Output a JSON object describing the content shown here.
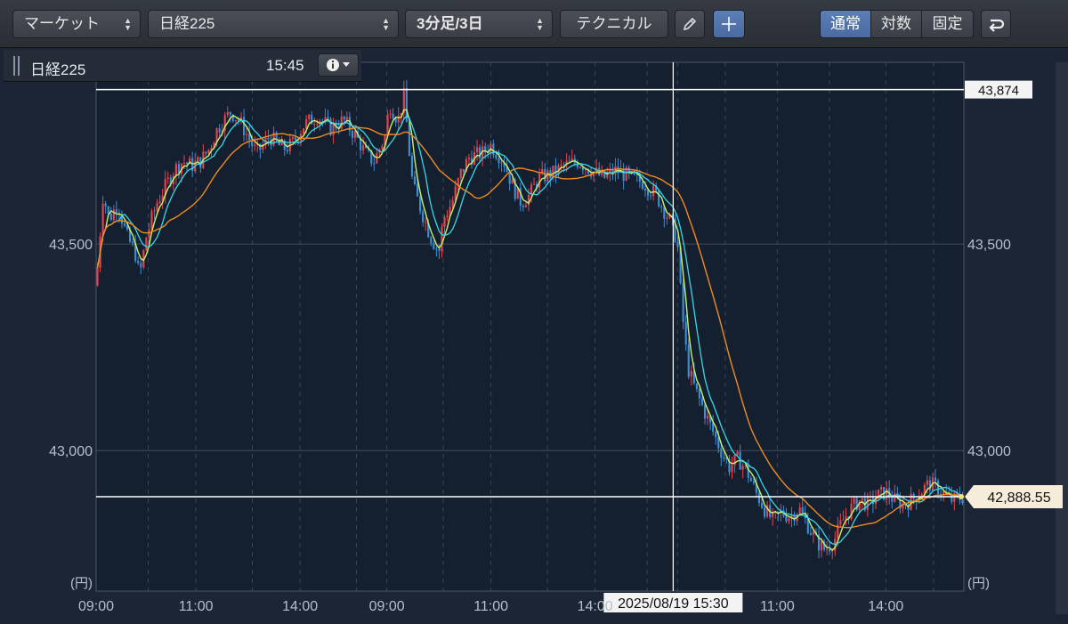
{
  "toolbar": {
    "market_select": "マーケット",
    "symbol_select": "日経225",
    "interval_select": "3分足/3日",
    "technical_button": "テクニカル",
    "mode_normal": "通常",
    "mode_log": "対数",
    "mode_fixed": "固定"
  },
  "infobar": {
    "symbol": "日経225",
    "time": "15:45"
  },
  "colors": {
    "up": "#e2454f",
    "down": "#3c8fd6",
    "ma_short": "#c8f06a",
    "ma_mid": "#37d8e6",
    "ma_long": "#f08a24",
    "grid": "#3a4456",
    "plot_bg": "#14202f"
  },
  "chart_data": {
    "type": "candlestick",
    "ylim": [
      42660,
      43940
    ],
    "yticks": [
      43000,
      43500
    ],
    "ytick_labels": [
      "43,000",
      "43,500"
    ],
    "unit_label": "(円)",
    "xtick_labels": [
      "09:00",
      "11:00",
      "14:00",
      "09:00",
      "11:00",
      "14:00",
      "11:00",
      "14:00"
    ],
    "hline_high": {
      "value": 43874,
      "label": "43,874"
    },
    "hline_last": {
      "value": 42888.55,
      "label": "42,888.55"
    },
    "crosshair_label": "2025/08/19 15:30",
    "close_path": [
      [
        0,
        43400
      ],
      [
        0.008,
        43620
      ],
      [
        0.015,
        43560
      ],
      [
        0.025,
        43600
      ],
      [
        0.035,
        43520
      ],
      [
        0.045,
        43480
      ],
      [
        0.05,
        43420
      ],
      [
        0.058,
        43520
      ],
      [
        0.07,
        43600
      ],
      [
        0.08,
        43640
      ],
      [
        0.09,
        43680
      ],
      [
        0.1,
        43700
      ],
      [
        0.11,
        43690
      ],
      [
        0.12,
        43700
      ],
      [
        0.13,
        43730
      ],
      [
        0.14,
        43780
      ],
      [
        0.155,
        43820
      ],
      [
        0.165,
        43800
      ],
      [
        0.175,
        43760
      ],
      [
        0.185,
        43720
      ],
      [
        0.2,
        43760
      ],
      [
        0.215,
        43730
      ],
      [
        0.225,
        43740
      ],
      [
        0.24,
        43790
      ],
      [
        0.255,
        43810
      ],
      [
        0.27,
        43780
      ],
      [
        0.285,
        43800
      ],
      [
        0.3,
        43760
      ],
      [
        0.31,
        43720
      ],
      [
        0.32,
        43700
      ],
      [
        0.333,
        43760
      ],
      [
        0.338,
        43840
      ],
      [
        0.348,
        43800
      ],
      [
        0.355,
        43860
      ],
      [
        0.36,
        43740
      ],
      [
        0.365,
        43640
      ],
      [
        0.375,
        43580
      ],
      [
        0.385,
        43520
      ],
      [
        0.395,
        43480
      ],
      [
        0.4,
        43560
      ],
      [
        0.41,
        43600
      ],
      [
        0.42,
        43670
      ],
      [
        0.43,
        43710
      ],
      [
        0.445,
        43720
      ],
      [
        0.455,
        43740
      ],
      [
        0.47,
        43700
      ],
      [
        0.48,
        43640
      ],
      [
        0.49,
        43600
      ],
      [
        0.5,
        43620
      ],
      [
        0.51,
        43660
      ],
      [
        0.525,
        43670
      ],
      [
        0.54,
        43690
      ],
      [
        0.555,
        43700
      ],
      [
        0.57,
        43680
      ],
      [
        0.585,
        43660
      ],
      [
        0.6,
        43680
      ],
      [
        0.615,
        43660
      ],
      [
        0.63,
        43650
      ],
      [
        0.645,
        43620
      ],
      [
        0.655,
        43580
      ],
      [
        0.665,
        43540
      ],
      [
        0.67,
        43500
      ],
      [
        0.673,
        43400
      ],
      [
        0.677,
        43300
      ],
      [
        0.682,
        43200
      ],
      [
        0.69,
        43150
      ],
      [
        0.7,
        43100
      ],
      [
        0.71,
        43050
      ],
      [
        0.72,
        43000
      ],
      [
        0.73,
        42960
      ],
      [
        0.74,
        42980
      ],
      [
        0.75,
        42950
      ],
      [
        0.76,
        42900
      ],
      [
        0.77,
        42860
      ],
      [
        0.78,
        42830
      ],
      [
        0.79,
        42850
      ],
      [
        0.8,
        42840
      ],
      [
        0.81,
        42860
      ],
      [
        0.82,
        42820
      ],
      [
        0.83,
        42780
      ],
      [
        0.84,
        42760
      ],
      [
        0.85,
        42780
      ],
      [
        0.86,
        42830
      ],
      [
        0.87,
        42860
      ],
      [
        0.88,
        42880
      ],
      [
        0.89,
        42870
      ],
      [
        0.9,
        42890
      ],
      [
        0.91,
        42900
      ],
      [
        0.92,
        42880
      ],
      [
        0.93,
        42870
      ],
      [
        0.94,
        42880
      ],
      [
        0.95,
        42900
      ],
      [
        0.96,
        42920
      ],
      [
        0.97,
        42910
      ],
      [
        0.985,
        42880
      ],
      [
        1.0,
        42888.55
      ]
    ]
  }
}
